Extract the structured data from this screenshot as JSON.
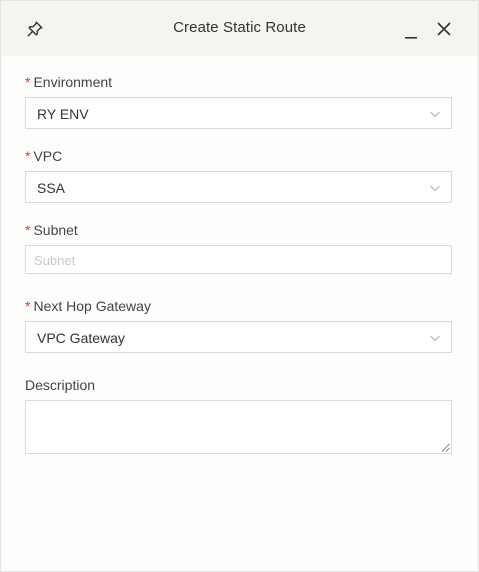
{
  "dialog": {
    "title": "Create Static Route"
  },
  "form": {
    "environment": {
      "label": "Environment",
      "required_mark": "*",
      "value": "RY ENV"
    },
    "vpc": {
      "label": "VPC",
      "required_mark": "*",
      "value": "SSA"
    },
    "subnet": {
      "label": "Subnet",
      "required_mark": "*",
      "placeholder": "Subnet",
      "value": ""
    },
    "next_hop_gateway": {
      "label": "Next Hop Gateway",
      "required_mark": "*",
      "value": "VPC Gateway"
    },
    "description": {
      "label": "Description",
      "value": ""
    }
  },
  "icons": {
    "pin": "pin-icon",
    "minimize": "minimize-icon",
    "close": "close-icon",
    "chevron": "chevron-down-icon"
  },
  "colors": {
    "header_bg": "#f4f4f1",
    "required": "#e8342e",
    "border": "#d9d9d9",
    "placeholder": "#c8c8c8"
  }
}
